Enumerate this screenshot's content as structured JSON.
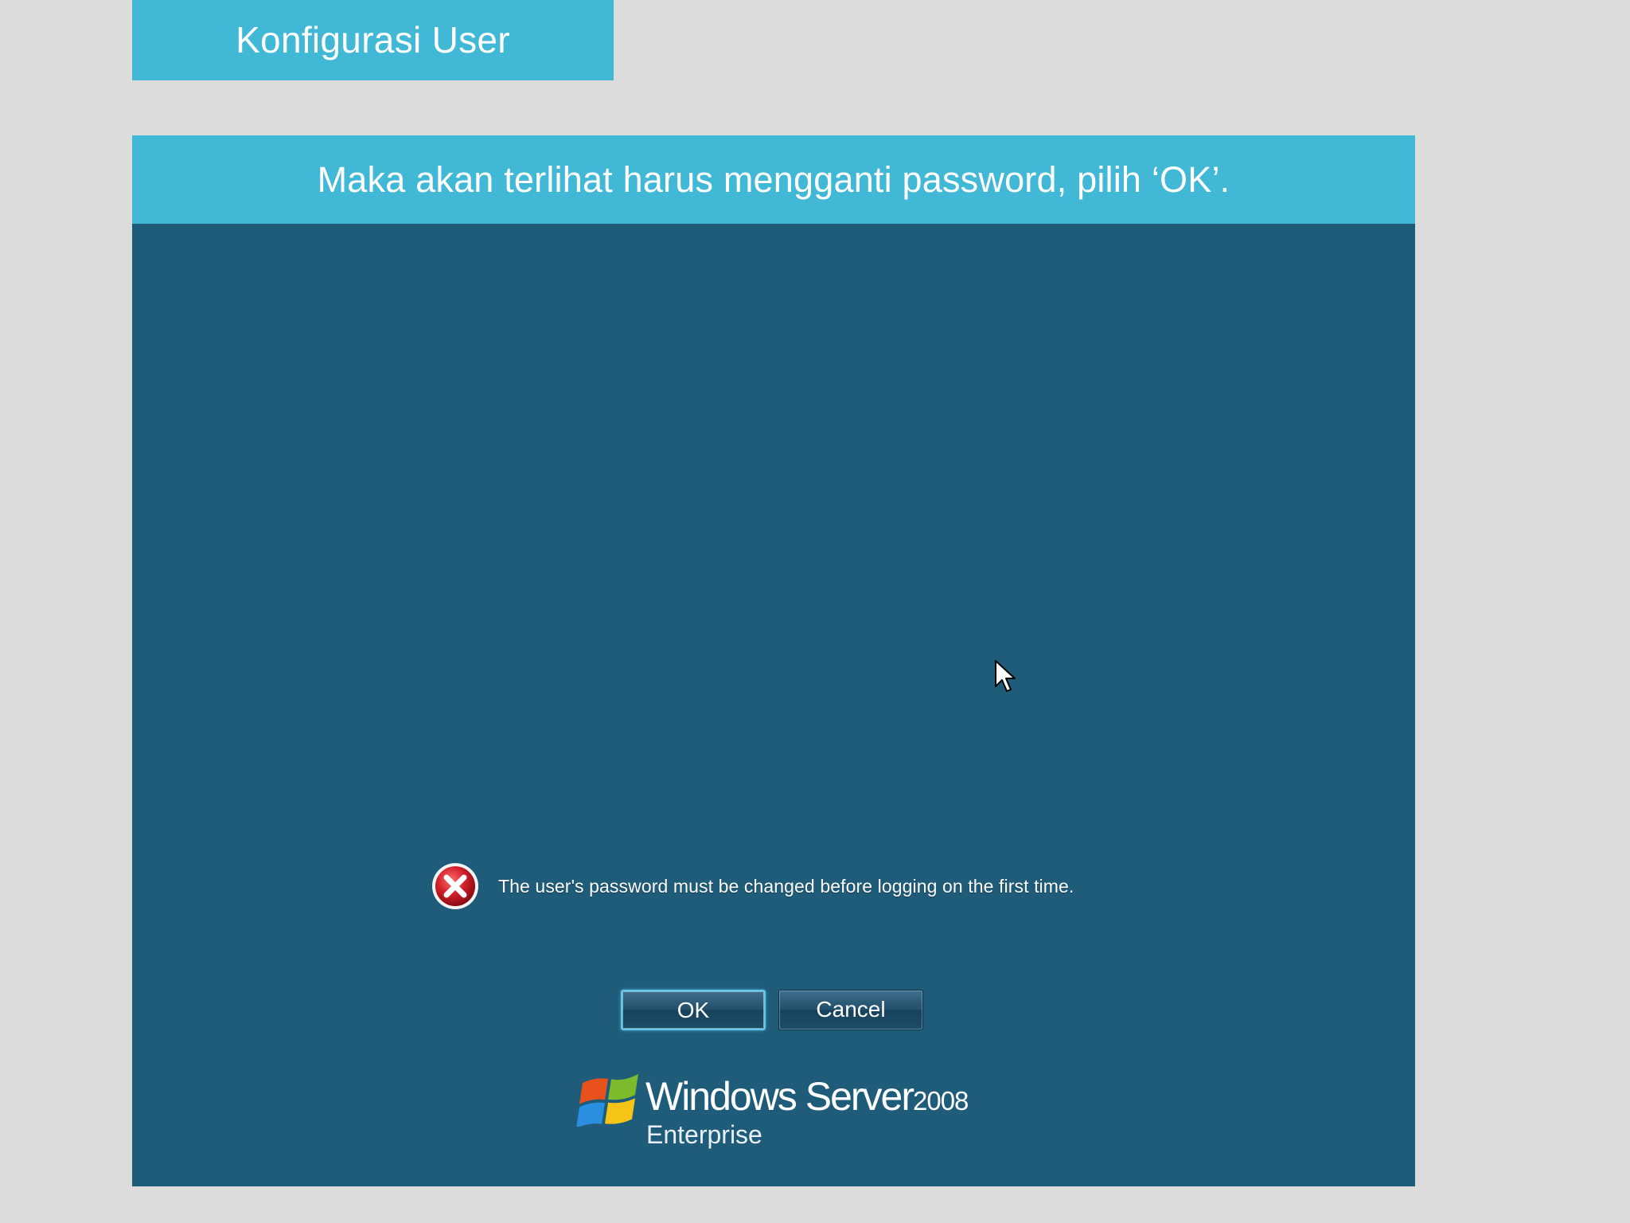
{
  "slide": {
    "title": "Konfigurasi User",
    "caption": "Maka akan terlihat harus mengganti password, pilih ‘OK’."
  },
  "dialog": {
    "message": "The user's password must be changed before logging on the first time.",
    "ok_label": "OK",
    "cancel_label": "Cancel",
    "icon": "error-icon"
  },
  "branding": {
    "product": "Windows Server",
    "version": "2008",
    "edition": "Enterprise",
    "logo": "windows-flag-logo"
  },
  "colors": {
    "slide_background": "#dcdcdc",
    "accent_bar": "#41b9d6",
    "login_background": "#1f5c7a",
    "error_red": "#c8202a"
  }
}
